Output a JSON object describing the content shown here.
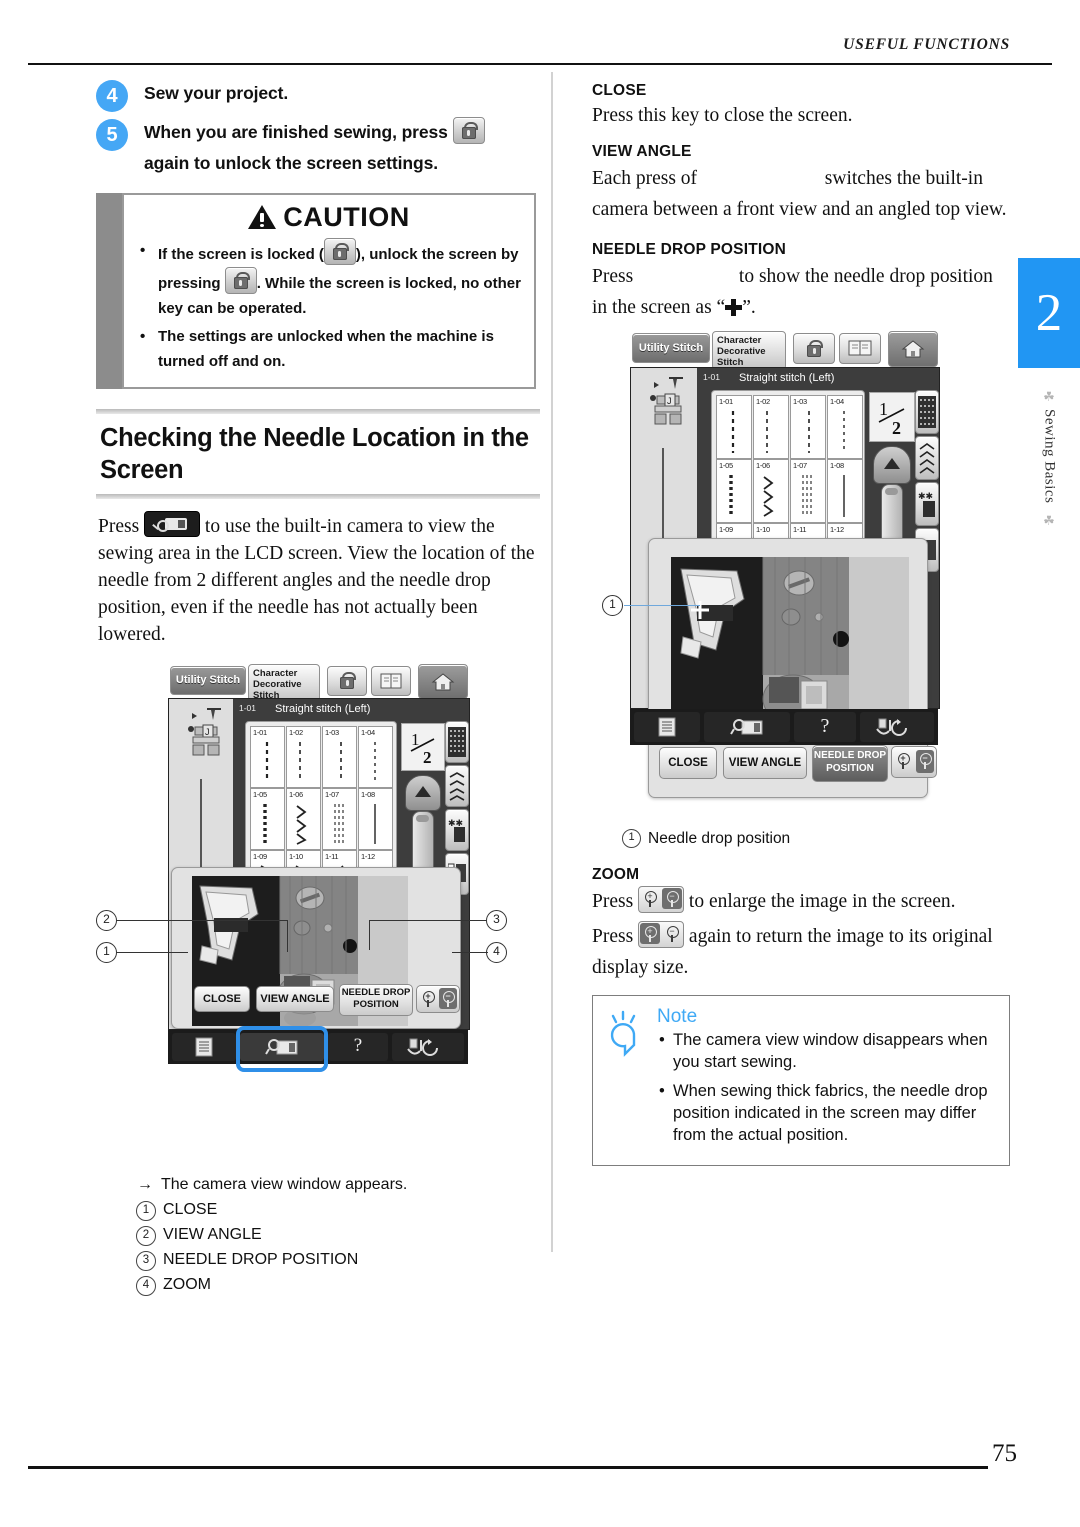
{
  "header": {
    "running_title": "USEFUL FUNCTIONS"
  },
  "chapter_tab": {
    "number": "2",
    "label": "Sewing Basics"
  },
  "footer": {
    "page_number": "75"
  },
  "left": {
    "steps": [
      {
        "number": "4",
        "text": "Sew your project."
      },
      {
        "number": "5",
        "text_before": "When you are finished sewing, press",
        "icon": "lock-button-icon",
        "text_after": "again to unlock the screen settings."
      }
    ],
    "caution": {
      "title": "CAUTION",
      "icon": "warning-triangle-icon",
      "bullets": [
        {
          "part1": "If the screen is locked (",
          "icon1": "lock-button-icon",
          "part2": "), unlock the screen by pressing",
          "icon2": "lock-button-icon",
          "part3": ". While the screen is locked, no other key can be operated."
        },
        {
          "part1": "The settings are unlocked when the machine is turned off and on.",
          "icon1": "",
          "part2": "",
          "icon2": "",
          "part3": ""
        }
      ]
    },
    "section_heading": "Checking the Needle Location in the Screen",
    "intro": {
      "before": "Press",
      "icon": "camera-view-button-icon",
      "after": "to use the built-in camera to view the sewing area in the LCD screen. View the location of the needle from 2 different angles and the needle drop position, even if the needle has not actually been lowered."
    },
    "lcd": {
      "tabs": [
        {
          "label": "Utility Stitch",
          "state": "selected"
        },
        {
          "label": "Character Decorative Stitch",
          "state": "normal"
        }
      ],
      "icon_buttons": [
        "lock-button-icon",
        "manual-button-icon",
        "home-button-icon"
      ],
      "stitch_number": "1-01",
      "stitch_name": "Straight stitch (Left)",
      "page_indicator": "1/2",
      "page_indicator_top": "1",
      "page_indicator_bottom": "2",
      "stitch_cells": [
        "1-01",
        "1-02",
        "1-03",
        "1-04",
        "1-05",
        "1-06",
        "1-07",
        "1-08",
        "1-09",
        "1-10",
        "1-11",
        "1-12"
      ],
      "camera_buttons": [
        {
          "label": "CLOSE",
          "callout": "1"
        },
        {
          "label": "VIEW ANGLE",
          "callout": "2"
        },
        {
          "label": "NEEDLE DROP POSITION",
          "callout": "3"
        },
        {
          "label": "zoom-in-out-button",
          "callout": "4"
        }
      ],
      "bottom_keys": [
        "settings-icon",
        "camera-view-icon",
        "help-icon",
        "presser-foot-icon"
      ]
    },
    "result_note": "The camera view window appears.",
    "result_arrow": "→",
    "captions": [
      {
        "num": "1",
        "label": "CLOSE"
      },
      {
        "num": "2",
        "label": "VIEW ANGLE"
      },
      {
        "num": "3",
        "label": "NEEDLE DROP POSITION"
      },
      {
        "num": "4",
        "label": "ZOOM"
      }
    ]
  },
  "right": {
    "sections": [
      {
        "heading": "CLOSE",
        "body": "Press this key to close the screen."
      },
      {
        "heading": "VIEW ANGLE",
        "body_before": "Each press of",
        "body_after": "switches the built-in camera between a front view and an angled top view."
      },
      {
        "heading": "NEEDLE DROP POSITION",
        "body_before": "Press",
        "body_mid": "to show the needle drop position in the screen as “",
        "body_after": "”."
      }
    ],
    "lcd": {
      "tabs": [
        {
          "label": "Utility Stitch",
          "state": "selected"
        },
        {
          "label": "Character Decorative Stitch",
          "state": "normal"
        }
      ],
      "stitch_number": "1-01",
      "stitch_name": "Straight stitch (Left)",
      "page_indicator_top": "1",
      "page_indicator_bottom": "2",
      "stitch_cells": [
        "1-01",
        "1-02",
        "1-03",
        "1-04",
        "1-05",
        "1-06",
        "1-07",
        "1-08",
        "1-09",
        "1-10",
        "1-11",
        "1-12"
      ],
      "camera_buttons": [
        {
          "label": "CLOSE"
        },
        {
          "label": "VIEW ANGLE"
        },
        {
          "label": "NEEDLE DROP POSITION",
          "state": "selected"
        },
        {
          "label": "zoom-in-out-button"
        }
      ],
      "callout": "1"
    },
    "lcd_caption": {
      "num": "1",
      "label": "Needle drop position"
    },
    "zoom_section": {
      "heading": "ZOOM",
      "line1_before": "Press",
      "line1_after": "to enlarge the image in the screen.",
      "line2_before": "Press",
      "line2_after": "again to return the image to its original display size."
    },
    "note": {
      "title": "Note",
      "icon": "lightbulb-icon",
      "items": [
        "The camera view window disappears when you start sewing.",
        "When sewing thick fabrics, the needle drop position indicated in the screen may differ from the actual position."
      ]
    }
  },
  "colors": {
    "accent_blue": "#2196f3",
    "step_bullet": "#45a7f5",
    "note_blue": "#3fa9f5",
    "caution_gray": "#8c8c8c"
  }
}
